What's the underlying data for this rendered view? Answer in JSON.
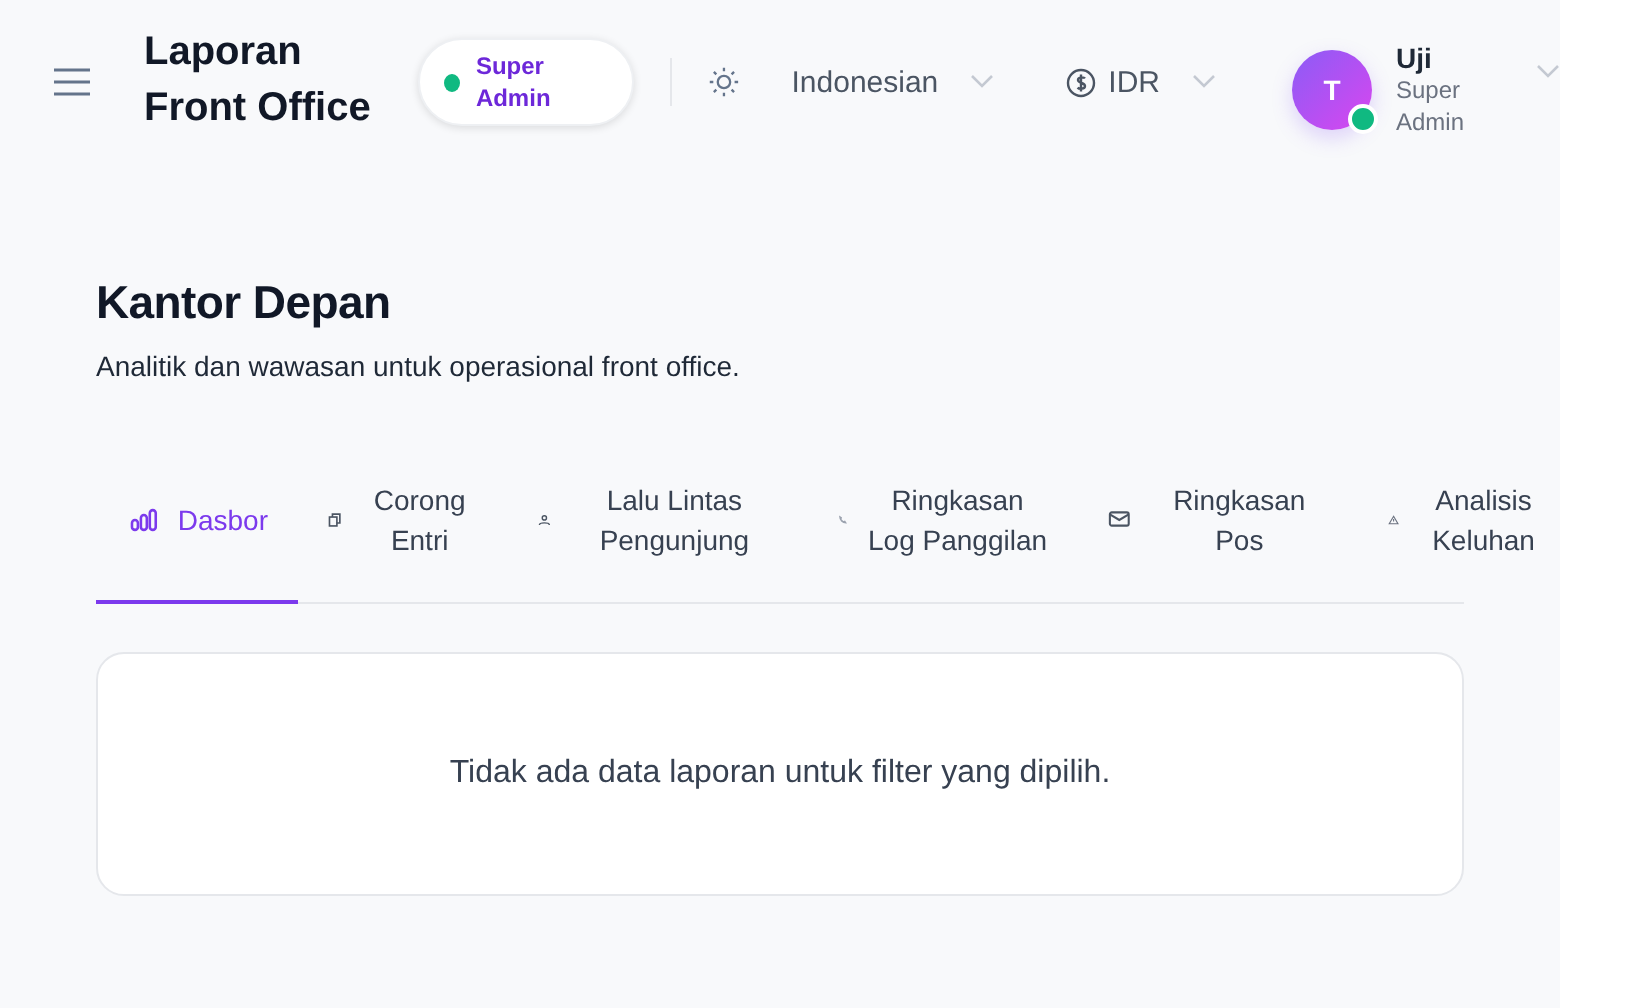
{
  "header": {
    "title": "Laporan Front Office",
    "role_badge": {
      "label": "Super Admin",
      "color": "#10b981"
    },
    "language": "Indonesian",
    "currency": "IDR",
    "user": {
      "initial": "T",
      "name": "Uji",
      "role": "Super Admin",
      "online": true
    }
  },
  "page": {
    "title": "Kantor Depan",
    "subtitle": "Analitik dan wawasan untuk operasional front office."
  },
  "tabs": [
    {
      "label": "Dasbor",
      "selected": true
    },
    {
      "label": "Corong Entri",
      "selected": false
    },
    {
      "label": "Lalu Lintas Pengunjung",
      "selected": false
    },
    {
      "label": "Ringkasan Log Panggilan",
      "selected": false
    },
    {
      "label": "Ringkasan Pos",
      "selected": false
    },
    {
      "label": "Analisis Keluhan",
      "selected": false
    }
  ],
  "empty_state": {
    "message": "Tidak ada data laporan untuk filter yang dipilih."
  }
}
